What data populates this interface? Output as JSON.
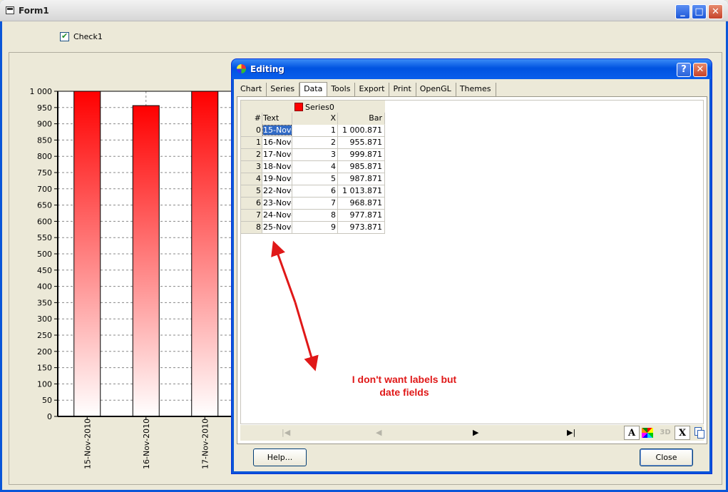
{
  "form1": {
    "title": "Form1",
    "minimize_label": "_",
    "maximize_label": "□",
    "close_label": "✕",
    "check1_label": "Check1",
    "check1_checked": true
  },
  "chart_data": {
    "type": "bar",
    "categories": [
      "15-Nov-2010",
      "16-Nov-2010",
      "17-Nov-2010"
    ],
    "values": [
      1000.871,
      955.871,
      999.871
    ],
    "ylim": [
      0,
      1000
    ],
    "y_ticks": [
      "1 000",
      "950",
      "900",
      "850",
      "800",
      "750",
      "700",
      "650",
      "600",
      "550",
      "500",
      "450",
      "400",
      "350",
      "300",
      "250",
      "200",
      "150",
      "100",
      "50",
      "0"
    ],
    "grid": true,
    "bar_gradient": [
      "#ff0000",
      "#ffffff"
    ]
  },
  "editing": {
    "title": "Editing",
    "help_icon_label": "?",
    "close_icon_label": "✕",
    "tabs": [
      "Chart",
      "Series",
      "Data",
      "Tools",
      "Export",
      "Print",
      "OpenGL",
      "Themes"
    ],
    "active_tab": "Data",
    "grid": {
      "series_name": "Series0",
      "headers": {
        "num": "#",
        "text": "Text",
        "x": "X",
        "bar": "Bar"
      },
      "rows": [
        {
          "num": "0",
          "text": "15-Nov-",
          "x": "1",
          "bar": "1 000.871"
        },
        {
          "num": "1",
          "text": "16-Nov-",
          "x": "2",
          "bar": "955.871"
        },
        {
          "num": "2",
          "text": "17-Nov-",
          "x": "3",
          "bar": "999.871"
        },
        {
          "num": "3",
          "text": "18-Nov-",
          "x": "4",
          "bar": "985.871"
        },
        {
          "num": "4",
          "text": "19-Nov-",
          "x": "5",
          "bar": "987.871"
        },
        {
          "num": "5",
          "text": "22-Nov-",
          "x": "6",
          "bar": "1 013.871"
        },
        {
          "num": "6",
          "text": "23-Nov-",
          "x": "7",
          "bar": "968.871"
        },
        {
          "num": "7",
          "text": "24-Nov-",
          "x": "8",
          "bar": "977.871"
        },
        {
          "num": "8",
          "text": "25-Nov-",
          "x": "9",
          "bar": "973.871"
        }
      ]
    },
    "nav": {
      "first": "|◀",
      "prev": "◀",
      "next": "▶",
      "last": "▶|"
    },
    "tools": {
      "font": "A",
      "three_d": "3D",
      "x": "X"
    },
    "help_button": "Help...",
    "close_button": "Close"
  },
  "annotation": {
    "text_line1": "I don't want labels but",
    "text_line2": "date fields",
    "color": "#e01818"
  }
}
